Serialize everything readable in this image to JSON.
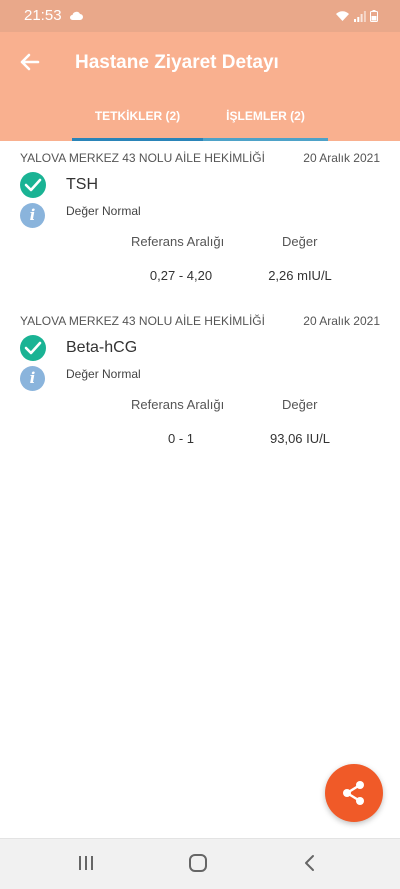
{
  "status_bar": {
    "time": "21:53"
  },
  "header": {
    "title": "Hastane Ziyaret Detayı",
    "tabs": [
      {
        "label": "TETKİKLER (2)",
        "selected": true
      },
      {
        "label": "İŞLEMLER (2)",
        "selected": false
      }
    ]
  },
  "tests": [
    {
      "hospital": "YALOVA MERKEZ 43 NOLU AİLE HEKİMLİĞİ",
      "date": "20 Aralık 2021",
      "name": "TSH",
      "info": "Değer Normal",
      "ref_label": "Referans Aralığı",
      "value_label": "Değer",
      "ref_range": "0,27 - 4,20",
      "value": "2,26 mIU/L"
    },
    {
      "hospital": "YALOVA MERKEZ 43 NOLU AİLE HEKİMLİĞİ",
      "date": "20 Aralık 2021",
      "name": "Beta-hCG",
      "info": "Değer Normal",
      "ref_label": "Referans Aralığı",
      "value_label": "Değer",
      "ref_range": "0 - 1",
      "value": "93,06 IU/L"
    }
  ],
  "colors": {
    "appbar": "#f9b08f",
    "statusbar": "#e9a88a",
    "check": "#1ab394",
    "info": "#8ab4dc",
    "fab": "#f05a28",
    "tab_indicator": "#2a84b8"
  },
  "icons": {
    "back": "arrow-left-icon",
    "check": "check-circle-icon",
    "info": "info-icon",
    "share": "share-icon"
  }
}
